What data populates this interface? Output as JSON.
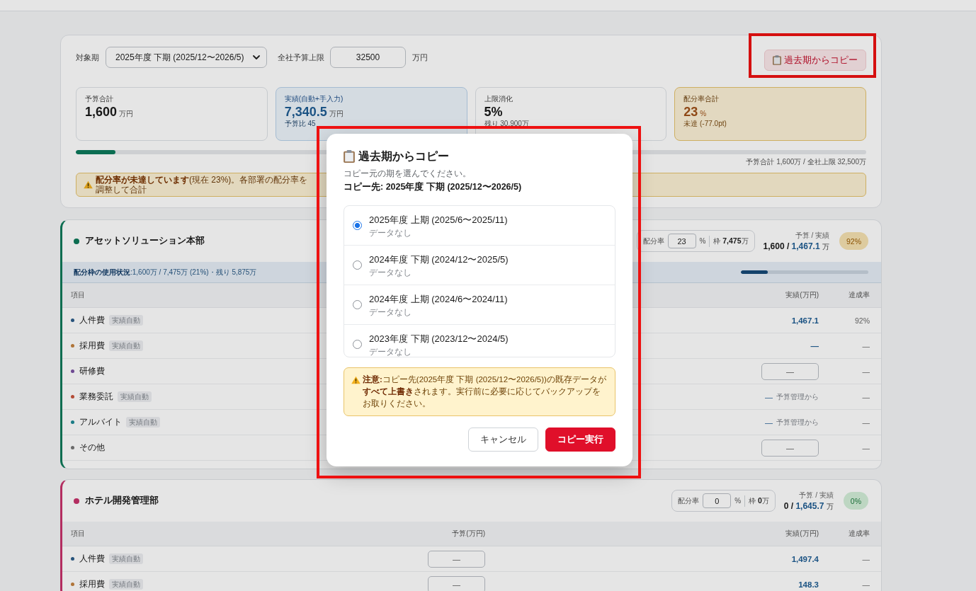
{
  "period_bar": {
    "period_label": "対象期",
    "period_select": "2025年度 下期 (2025/12〜2026/5)",
    "cap_label": "全社予算上限",
    "cap_value": "32500",
    "cap_unit": "万円",
    "copy_button": "過去期からコピー"
  },
  "stats": [
    {
      "kind": "plain",
      "label": "予算合計",
      "value": "1,600",
      "unit": "万円"
    },
    {
      "kind": "actual",
      "label": "実績(自動+手入力)",
      "value": "7,340.5",
      "unit": "万円",
      "sub": "予算比 45"
    },
    {
      "kind": "plain",
      "label": "上限消化",
      "value": "5%",
      "sub": "残り 30,900万"
    },
    {
      "kind": "warning",
      "label": "配分率合計",
      "value": "23",
      "unit": "%",
      "sub": "未達 (-77.0pt)"
    }
  ],
  "cap_progress": {
    "level": 0.05,
    "caption": "予算合計 1,600万 / 全社上限 32,500万"
  },
  "alert": {
    "text": "**配分率が未達しています**(現在 23%)。各部署の配分率を調整して合計"
  },
  "departments": [
    {
      "name": "アセットソリューション本部",
      "color": "#0d6e51",
      "allocation": {
        "label": "配分率",
        "rate": "23",
        "unit": "%",
        "quota": "枠 **7,475**万"
      },
      "summary": {
        "label": "予算 / 実績",
        "budget": "1,600",
        "separator": "/",
        "actual": "1,467.1",
        "unit": "万"
      },
      "achievement": {
        "text": "92%",
        "kind": "warning"
      },
      "usage": {
        "text": "**配分枠の使用状況**:1,600万 / 7,475万 (21%)・残り 5,875万",
        "level": 0.21
      },
      "columns": {
        "item": "項目",
        "actual": "実績(万円)",
        "rate": "達成率"
      },
      "rows": [
        {
          "name": "人件費",
          "color": "#28547c",
          "tag": "実績自動",
          "actual": {
            "kind": "value",
            "text": "1,467.1"
          },
          "rate": "92%"
        },
        {
          "name": "採用費",
          "color": "#b07539",
          "tag": "実績自動",
          "actual": {
            "kind": "value",
            "text": "—"
          },
          "rate": "—"
        },
        {
          "name": "研修費",
          "color": "#6f4a93",
          "actual": {
            "kind": "input",
            "placeholder": "—"
          },
          "rate": "—"
        },
        {
          "name": "業務委託",
          "color": "#b44c36",
          "tag": "実績自動",
          "actual": {
            "kind": "linked",
            "text": "—",
            "note": "予算管理から"
          },
          "rate": "—"
        },
        {
          "name": "アルバイト",
          "color": "#1a7c86",
          "tag": "実績自動",
          "actual": {
            "kind": "linked",
            "text": "—",
            "note": "予算管理から"
          },
          "rate": "—"
        },
        {
          "name": "その他",
          "color": "#6b6b6b",
          "actual": {
            "kind": "input",
            "placeholder": "—"
          },
          "rate": "—"
        }
      ]
    },
    {
      "name": "ホテル開発管理部",
      "color": "#b42e60",
      "allocation": {
        "label": "配分率",
        "rate": "0",
        "unit": "%",
        "quota": "枠 **0**万"
      },
      "summary": {
        "label": "予算 / 実績",
        "budget": "0",
        "separator": "/",
        "actual": "1,645.7",
        "unit": "万"
      },
      "achievement": {
        "text": "0%",
        "kind": "success"
      },
      "columns": {
        "item": "項目",
        "budget": "予算(万円)",
        "actual": "実績(万円)",
        "rate": "達成率"
      },
      "rows": [
        {
          "name": "人件費",
          "color": "#28547c",
          "tag": "実績自動",
          "budget": {
            "placeholder": "—"
          },
          "actual": {
            "kind": "value",
            "text": "1,497.4"
          },
          "rate": "—"
        },
        {
          "name": "採用費",
          "color": "#b07539",
          "tag": "実績自動",
          "budget": {
            "placeholder": "—"
          },
          "actual": {
            "kind": "value",
            "text": "148.3"
          },
          "rate": "—"
        }
      ]
    }
  ],
  "dialog": {
    "title": "過去期からコピー",
    "instruction": "コピー元の期を選んでください。",
    "target": "コピー先: 2025年度 下期 (2025/12〜2026/5)",
    "options": [
      {
        "label": "2025年度 上期 (2025/6〜2025/11)",
        "note": "データなし",
        "selected": true
      },
      {
        "label": "2024年度 下期 (2024/12〜2025/5)",
        "note": "データなし",
        "selected": false
      },
      {
        "label": "2024年度 上期 (2024/6〜2024/11)",
        "note": "データなし",
        "selected": false
      },
      {
        "label": "2023年度 下期 (2023/12〜2024/5)",
        "note": "データなし",
        "selected": false
      }
    ],
    "notice": "**注意:**コピー先(2025年度 下期 (2025/12〜2026/5))の既存データが**すべて上書き**されます。実行前に必要に応じてバックアップをお取りください。",
    "buttons": [
      {
        "label": "キャンセル",
        "kind": "secondary"
      },
      {
        "label": "コピー実行",
        "kind": "primary"
      }
    ]
  }
}
